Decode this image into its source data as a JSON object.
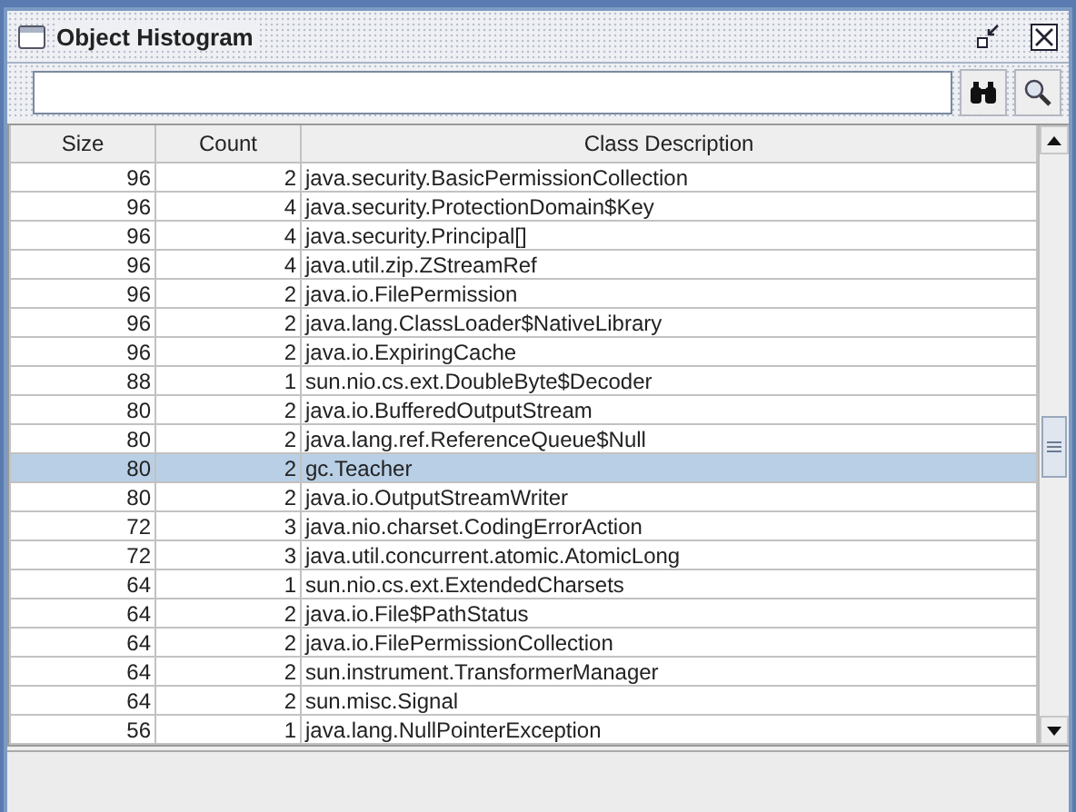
{
  "window": {
    "title": "Object Histogram"
  },
  "table": {
    "columns": [
      "Size",
      "Count",
      "Class Description"
    ],
    "rows": [
      {
        "size": "96",
        "count": "2",
        "class": "java.security.BasicPermissionCollection",
        "selected": false
      },
      {
        "size": "96",
        "count": "4",
        "class": "java.security.ProtectionDomain$Key",
        "selected": false
      },
      {
        "size": "96",
        "count": "4",
        "class": "java.security.Principal[]",
        "selected": false
      },
      {
        "size": "96",
        "count": "4",
        "class": "java.util.zip.ZStreamRef",
        "selected": false
      },
      {
        "size": "96",
        "count": "2",
        "class": "java.io.FilePermission",
        "selected": false
      },
      {
        "size": "96",
        "count": "2",
        "class": "java.lang.ClassLoader$NativeLibrary",
        "selected": false
      },
      {
        "size": "96",
        "count": "2",
        "class": "java.io.ExpiringCache",
        "selected": false
      },
      {
        "size": "88",
        "count": "1",
        "class": "sun.nio.cs.ext.DoubleByte$Decoder",
        "selected": false
      },
      {
        "size": "80",
        "count": "2",
        "class": "java.io.BufferedOutputStream",
        "selected": false
      },
      {
        "size": "80",
        "count": "2",
        "class": "java.lang.ref.ReferenceQueue$Null",
        "selected": false
      },
      {
        "size": "80",
        "count": "2",
        "class": "gc.Teacher",
        "selected": true
      },
      {
        "size": "80",
        "count": "2",
        "class": "java.io.OutputStreamWriter",
        "selected": false
      },
      {
        "size": "72",
        "count": "3",
        "class": "java.nio.charset.CodingErrorAction",
        "selected": false
      },
      {
        "size": "72",
        "count": "3",
        "class": "java.util.concurrent.atomic.AtomicLong",
        "selected": false
      },
      {
        "size": "64",
        "count": "1",
        "class": "sun.nio.cs.ext.ExtendedCharsets",
        "selected": false
      },
      {
        "size": "64",
        "count": "2",
        "class": "java.io.File$PathStatus",
        "selected": false
      },
      {
        "size": "64",
        "count": "2",
        "class": "java.io.FilePermissionCollection",
        "selected": false
      },
      {
        "size": "64",
        "count": "2",
        "class": "sun.instrument.TransformerManager",
        "selected": false
      },
      {
        "size": "64",
        "count": "2",
        "class": "sun.misc.Signal",
        "selected": false
      },
      {
        "size": "56",
        "count": "1",
        "class": "java.lang.NullPointerException",
        "selected": false
      }
    ]
  }
}
